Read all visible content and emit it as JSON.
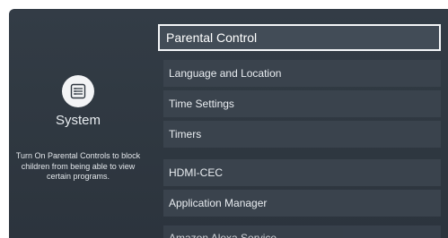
{
  "left_panel": {
    "icon": "settings-list-icon",
    "title": "System",
    "description": "Turn On Parental Controls to block children from being able to view certain programs."
  },
  "menu": {
    "header": "Parental Control",
    "items": [
      "Language and Location",
      "Time Settings",
      "Timers",
      "HDMI-CEC",
      "Application Manager",
      "Amazon Alexa Service"
    ]
  },
  "colors": {
    "background": "#303942",
    "item_background": "#3a434d",
    "focus_border": "#f4f6f8"
  }
}
